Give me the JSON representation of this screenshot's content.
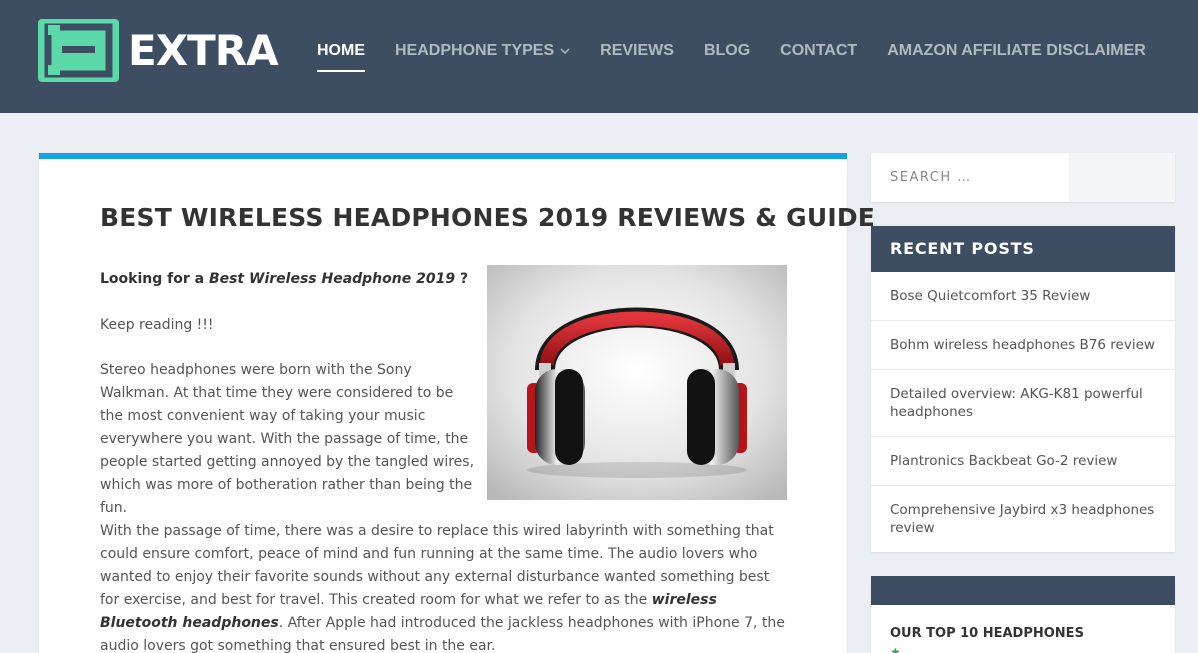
{
  "site": {
    "logo_text": "EXTRA",
    "logo_icon": "extra-e-logo-icon",
    "accent_color": "#5cd9a8",
    "header_color": "#3d4e62"
  },
  "nav": {
    "items": [
      {
        "label": "HOME",
        "active": true
      },
      {
        "label": "HEADPHONE TYPES",
        "has_dropdown": true
      },
      {
        "label": "REVIEWS"
      },
      {
        "label": "BLOG"
      },
      {
        "label": "CONTACT"
      },
      {
        "label": "AMAZON AFFILIATE DISCLAIMER"
      }
    ]
  },
  "article": {
    "title": "BEST WIRELESS HEADPHONES 2019 REVIEWS & GUIDE",
    "intro_prefix": "Looking for a ",
    "intro_em": "Best Wireless Headphone 2019",
    "intro_suffix": " ?",
    "keep_reading": "Keep reading !!!",
    "stereo_paragraph": "Stereo headphones were born with the Sony Walkman. At that time they were considered to be the most convenient way of taking your music everywhere you want. With the passage of time, the people started getting annoyed by the tangled wires, which was more of botheration rather than being the fun.",
    "passage_part1": "With the passage of time, there was a desire to replace this wired labyrinth with something that could ensure comfort, peace of mind and fun running at the same time. The audio lovers who wanted to enjoy their favorite sounds without any external disturbance wanted something best for exercise, and best for travel. This created room for what we refer to as the ",
    "passage_strong": "wireless Bluetooth headphones",
    "passage_part2": ". After Apple had introduced the jackless headphones with iPhone 7, the audio lovers got something that ensured best in the ear.",
    "accent_color": "#15a0e8"
  },
  "sidebar": {
    "search_placeholder": "SEARCH …",
    "recent_posts": {
      "title": "RECENT POSTS",
      "items": [
        "Bose Quietcomfort 35 Review",
        "Bohm wireless headphones B76 review",
        "Detailed overview: AKG-K81 powerful headphones",
        "Plantronics Backbeat Go-2 review",
        "Comprehensive Jaybird x3 headphones review"
      ]
    },
    "top10": {
      "title": "OUR TOP 10 HEADPHONES",
      "first_item_icon": "star-icon"
    }
  }
}
